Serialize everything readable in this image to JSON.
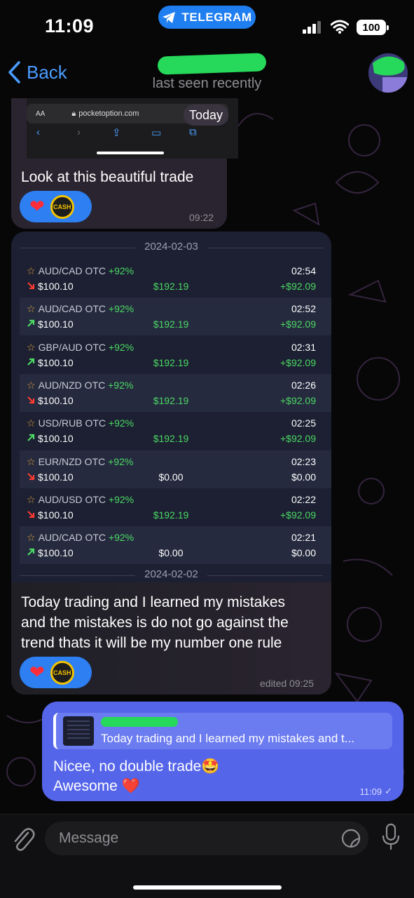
{
  "status": {
    "time": "11:09",
    "pill": "TELEGRAM",
    "battery": "100"
  },
  "header": {
    "back": "Back",
    "subtitle": "last seen recently"
  },
  "msg1": {
    "browser_aa": "AA",
    "browser_domain": "pocketoption.com",
    "date_badge": "Today",
    "text": "Look at this beautiful trade",
    "time": "09:22"
  },
  "msg2": {
    "date_top": "2024-02-03",
    "trades": [
      {
        "pair": "AUD/CAD OTC",
        "pct": "+92%",
        "amount": "$100.10",
        "dir": "down",
        "result": "$192.19",
        "time": "02:54",
        "profit": "+$92.09"
      },
      {
        "pair": "AUD/CAD OTC",
        "pct": "+92%",
        "amount": "$100.10",
        "dir": "up",
        "result": "$192.19",
        "time": "02:52",
        "profit": "+$92.09"
      },
      {
        "pair": "GBP/AUD OTC",
        "pct": "+92%",
        "amount": "$100.10",
        "dir": "up",
        "result": "$192.19",
        "time": "02:31",
        "profit": "+$92.09"
      },
      {
        "pair": "AUD/NZD OTC",
        "pct": "+92%",
        "amount": "$100.10",
        "dir": "down",
        "result": "$192.19",
        "time": "02:26",
        "profit": "+$92.09"
      },
      {
        "pair": "USD/RUB OTC",
        "pct": "+92%",
        "amount": "$100.10",
        "dir": "up",
        "result": "$192.19",
        "time": "02:25",
        "profit": "+$92.09"
      },
      {
        "pair": "EUR/NZD OTC",
        "pct": "+92%",
        "amount": "$100.10",
        "dir": "down",
        "result": "$0.00",
        "time": "02:23",
        "profit": "$0.00"
      },
      {
        "pair": "AUD/USD OTC",
        "pct": "+92%",
        "amount": "$100.10",
        "dir": "down",
        "result": "$192.19",
        "time": "02:22",
        "profit": "+$92.09"
      },
      {
        "pair": "AUD/CAD OTC",
        "pct": "+92%",
        "amount": "$100.10",
        "dir": "up",
        "result": "$0.00",
        "time": "02:21",
        "profit": "$0.00"
      }
    ],
    "date_bottom": "2024-02-02",
    "text_lines": [
      "Today trading and I learned my mistakes",
      "and the mistakes is do not go against the",
      "trend thats it will be my number one rule"
    ],
    "time": "edited 09:25"
  },
  "msg3": {
    "reply_text": "Today trading and I learned my mistakes and t...",
    "line1": "Nicee, no double trade🤩",
    "line2": "Awesome ❤️",
    "time": "11:09"
  },
  "input": {
    "placeholder": "Message"
  },
  "colors": {
    "accent": "#4a9dff",
    "outgoing": "#5565ea",
    "profit": "#4cd964",
    "reaction": "#2d7ff2"
  }
}
